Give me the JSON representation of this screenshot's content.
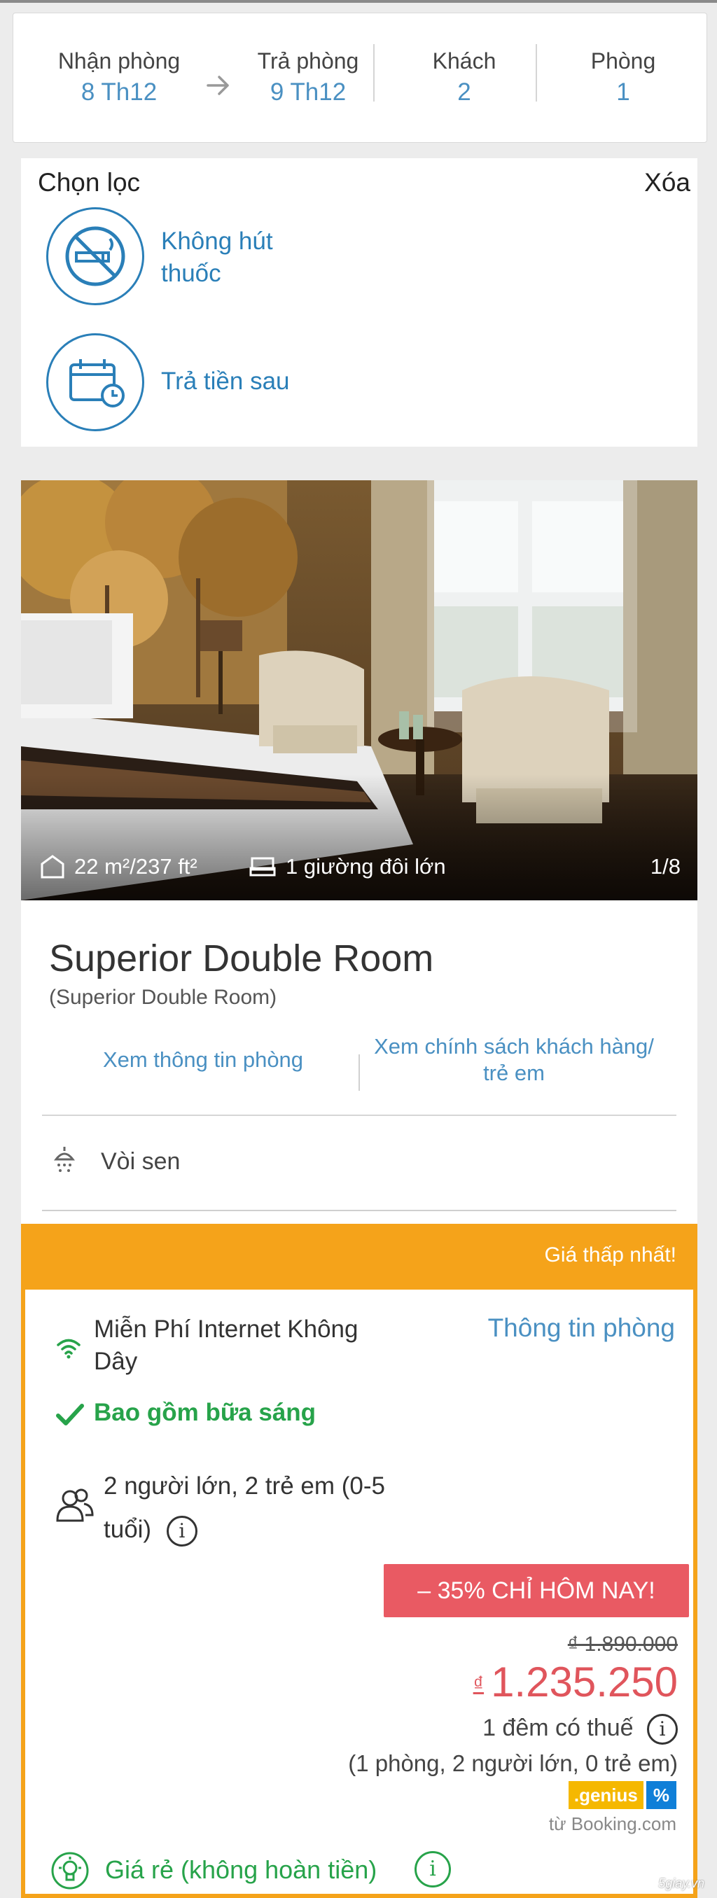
{
  "search": {
    "checkin_label": "Nhận phòng",
    "checkin_value": "8 Th12",
    "checkout_label": "Trả phòng",
    "checkout_value": "9 Th12",
    "guests_label": "Khách",
    "guests_value": "2",
    "rooms_label": "Phòng",
    "rooms_value": "1"
  },
  "filters": {
    "title": "Chọn lọc",
    "clear_label": "Xóa",
    "items": [
      {
        "label_line1": "Không hút",
        "label_line2": "thuốc",
        "icon": "no-smoking-icon"
      },
      {
        "label_line1": "Trả tiền sau",
        "label_line2": "",
        "icon": "calendar-clock-icon"
      }
    ]
  },
  "room": {
    "size": "22 m²/237 ft²",
    "bed": "1 giường đôi lớn",
    "photo_counter": "1/8",
    "name": "Superior Double Room",
    "subtitle": "(Superior Double Room)",
    "link_info": "Xem thông tin phòng",
    "link_policy_line1": "Xem chính sách khách hàng/",
    "link_policy_line2": "trẻ em",
    "amenity": "Vòi sen"
  },
  "offer": {
    "banner": "Giá thấp nhất!",
    "wifi_line1": "Miễn Phí Internet Không",
    "wifi_line2": "Dây",
    "room_info_link": "Thông tin phòng",
    "breakfast": "Bao gồm bữa sáng",
    "guests_line1": "2 người lớn, 2 trẻ em (0-5",
    "guests_line2": "tuổi)",
    "info_glyph": "i",
    "discount": "– 35% CHỈ HÔM NAY!",
    "old_price": "₫ 1.890.000",
    "currency": "₫",
    "new_price": "1.235.250",
    "per_night": "1 đêm có thuế",
    "occupancy": "(1 phòng, 2 người lớn, 0 trẻ em)",
    "genius_label": ".genius",
    "genius_percent": "%",
    "source": "từ Booking.com",
    "cheap_label": "Giá rẻ (không hoàn tiền)"
  },
  "watermark": "5giay.vn",
  "colors": {
    "accent_blue": "#4a90c2",
    "orange": "#f5a31a",
    "sale_red": "#e95a63",
    "green": "#27a34a"
  }
}
